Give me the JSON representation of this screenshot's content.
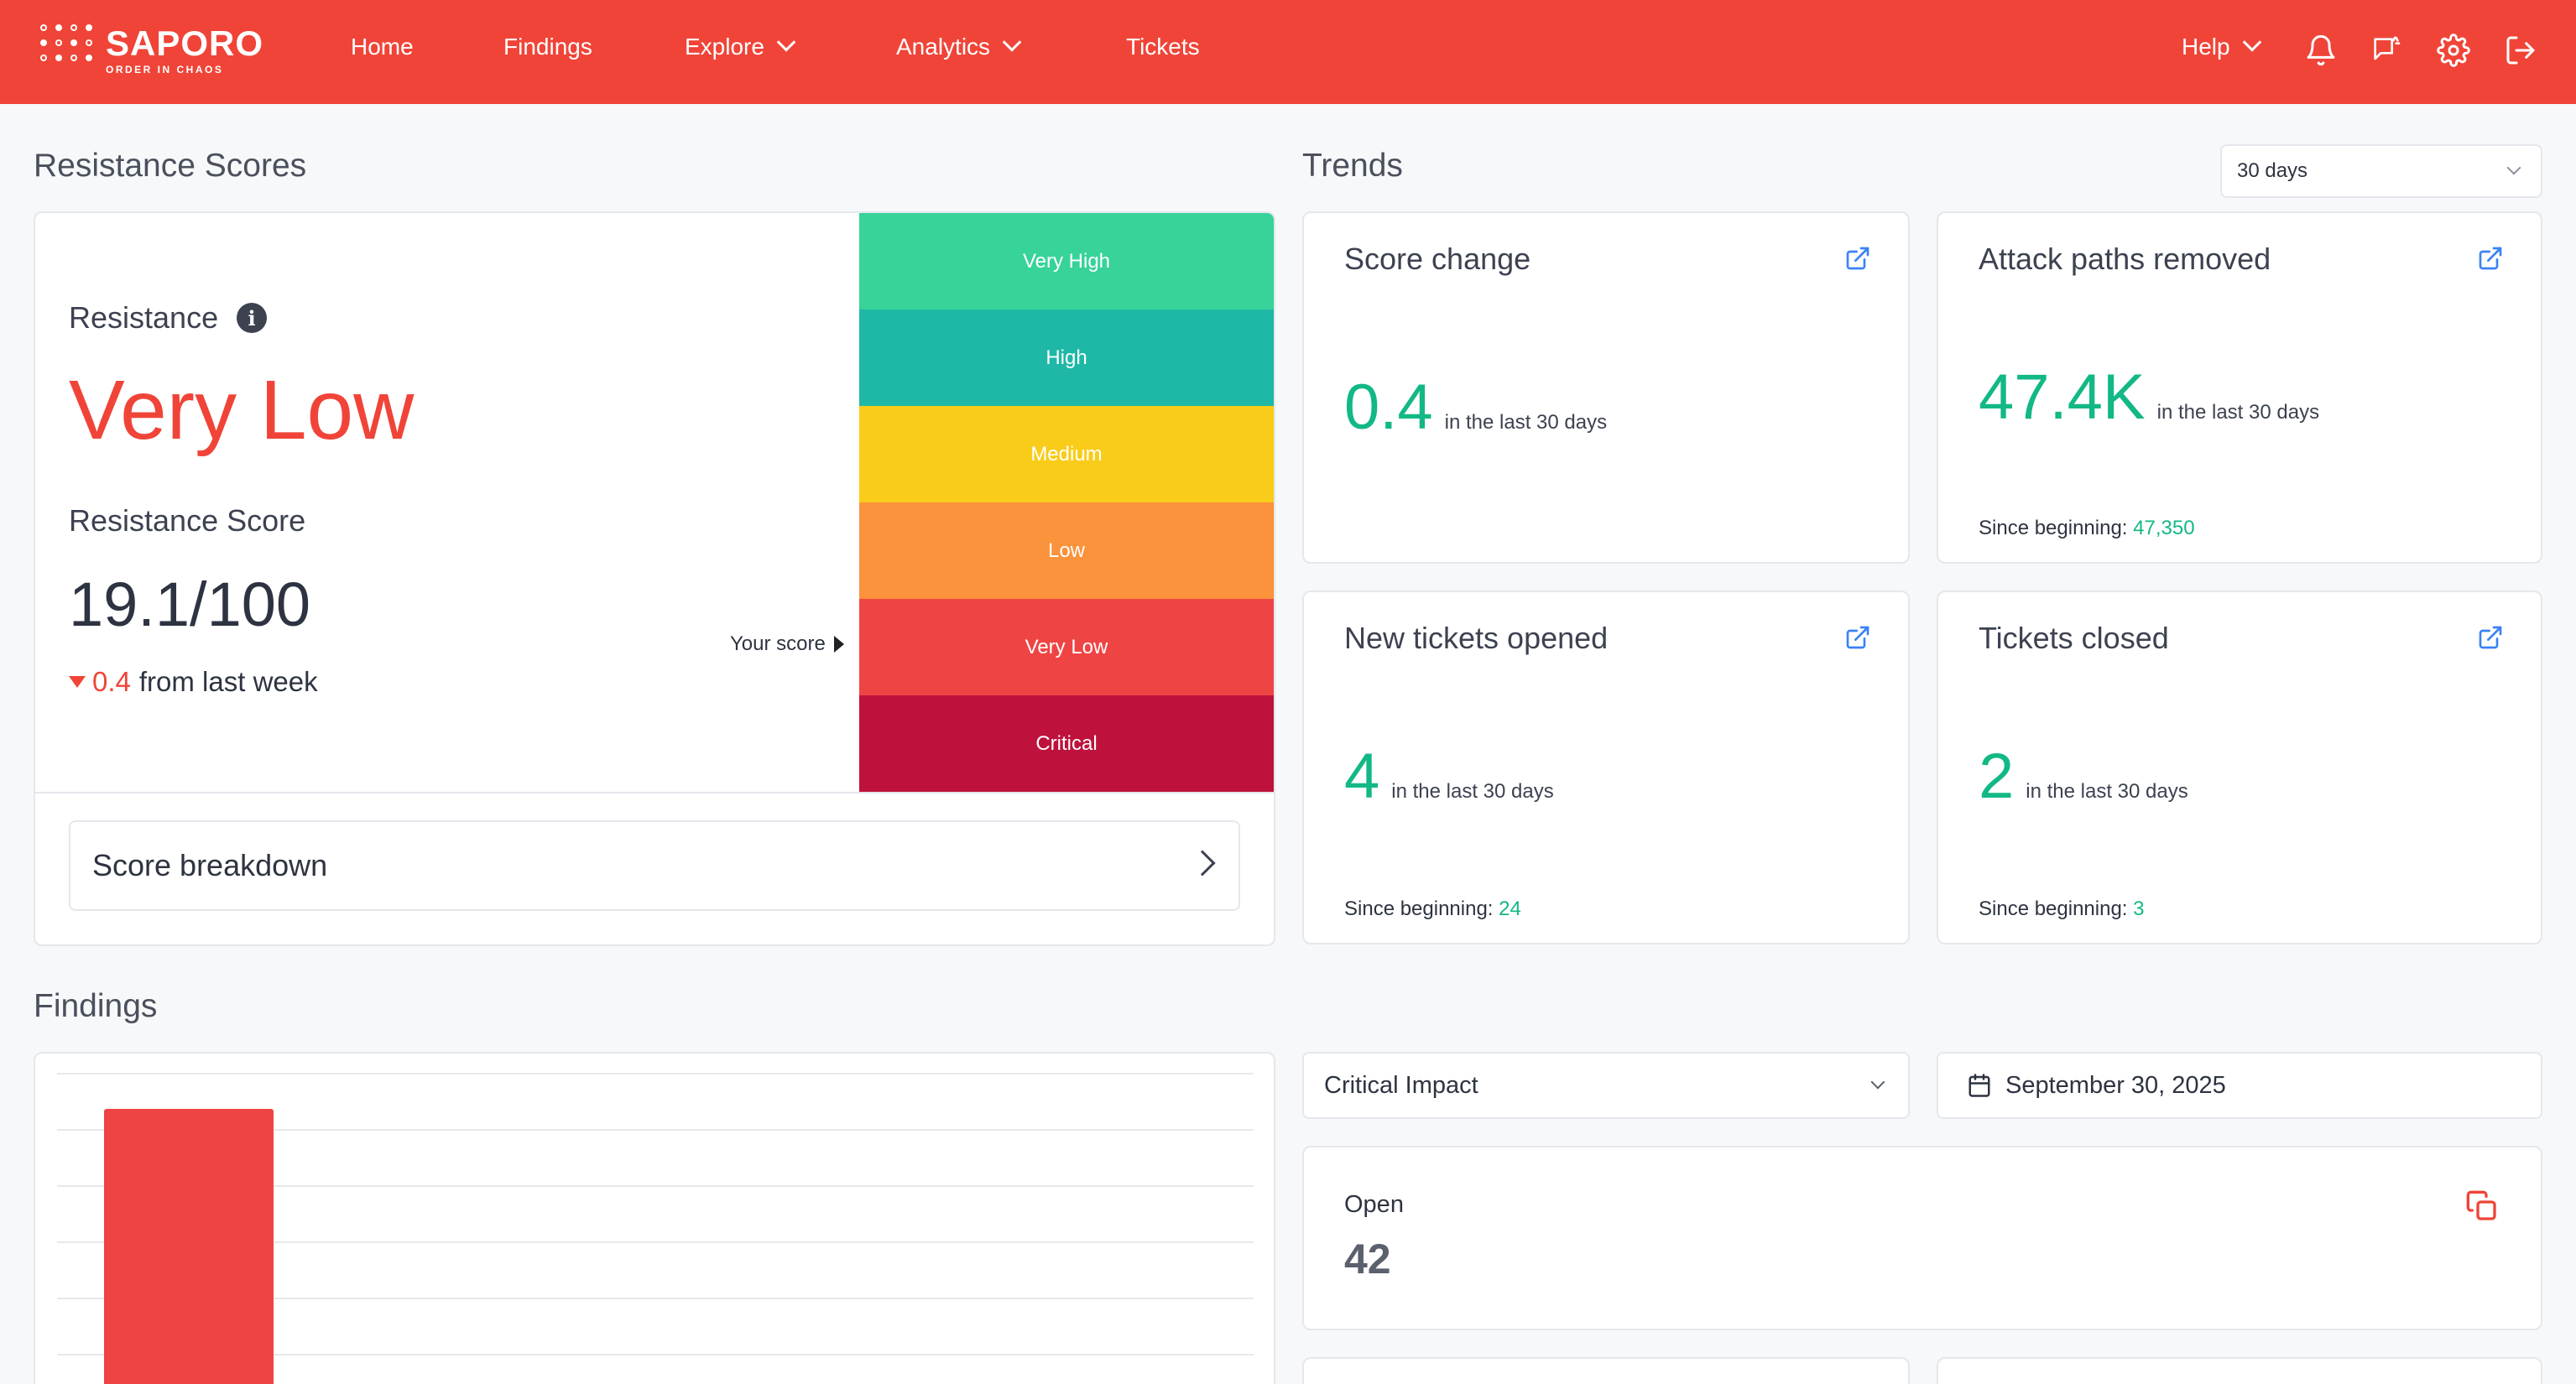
{
  "brand": {
    "name": "SAPORO",
    "tagline": "ORDER IN CHAOS",
    "accent": "#f04438"
  },
  "nav": {
    "items": [
      {
        "label": "Home"
      },
      {
        "label": "Findings"
      },
      {
        "label": "Explore"
      },
      {
        "label": "Analytics"
      },
      {
        "label": "Tickets"
      }
    ],
    "help_label": "Help",
    "icons": [
      "bell-icon",
      "announcement-icon",
      "gear-icon",
      "logout-icon"
    ]
  },
  "resistance": {
    "section_title": "Resistance Scores",
    "label": "Resistance",
    "level": "Very Low",
    "score_label": "Resistance Score",
    "score": "19.1/100",
    "delta_value": "0.4",
    "delta_text": "from last week",
    "your_score_label": "Your score",
    "current_level_value": 19.1,
    "levels": [
      {
        "label": "Very High",
        "color": "#37d399"
      },
      {
        "label": "High",
        "color": "#1fb8a6"
      },
      {
        "label": "Medium",
        "color": "#f9cc1a"
      },
      {
        "label": "Low",
        "color": "#fb923c"
      },
      {
        "label": "Very Low",
        "color": "#ef4444"
      },
      {
        "label": "Critical",
        "color": "#be123c"
      }
    ],
    "breakdown_label": "Score breakdown"
  },
  "trends": {
    "section_title": "Trends",
    "period_select": "30 days",
    "cards": [
      {
        "title": "Score change",
        "value": "0.4",
        "sub": "in the last 30 days",
        "since_label": "",
        "since_value": ""
      },
      {
        "title": "Attack paths removed",
        "value": "47.4K",
        "sub": "in the last 30 days",
        "since_label": "Since beginning:",
        "since_value": "47,350"
      },
      {
        "title": "New tickets opened",
        "value": "4",
        "sub": "in the last 30 days",
        "since_label": "Since beginning:",
        "since_value": "24"
      },
      {
        "title": "Tickets closed",
        "value": "2",
        "sub": "in the last 30 days",
        "since_label": "Since beginning:",
        "since_value": "3"
      }
    ]
  },
  "findings": {
    "section_title": "Findings",
    "impact_select": "Critical Impact",
    "date_value": "September 30, 2025",
    "open_label": "Open",
    "open_value": "42"
  },
  "chart_data": {
    "type": "bar",
    "categories": [
      ""
    ],
    "values": [
      42
    ],
    "title": "",
    "xlabel": "",
    "ylabel": "",
    "color": "#ef4444",
    "grid": true
  }
}
